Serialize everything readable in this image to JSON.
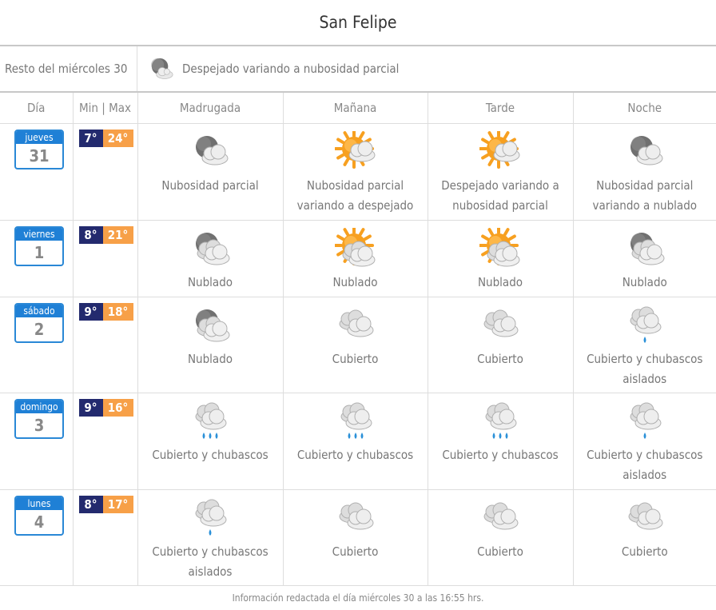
{
  "location": "San Felipe",
  "rest_of_day": {
    "label": "Resto del miércoles 30",
    "icon": "moon-cloud-icon",
    "condition": "Despejado variando a nubosidad parcial"
  },
  "headers": [
    "Día",
    "Min | Max",
    "Madrugada",
    "Mañana",
    "Tarde",
    "Noche"
  ],
  "days": [
    {
      "weekday": "jueves",
      "day": "31",
      "min": "7°",
      "max": "24°",
      "periods": [
        {
          "icon": "moon-cloud-icon",
          "text": "Nubosidad parcial"
        },
        {
          "icon": "sun-cloud-icon",
          "text": "Nubosidad parcial variando a despejado"
        },
        {
          "icon": "sun-cloud-icon",
          "text": "Despejado variando a nubosidad parcial"
        },
        {
          "icon": "moon-cloud-icon",
          "text": "Nubosidad parcial variando a nublado"
        }
      ]
    },
    {
      "weekday": "viernes",
      "day": "1",
      "min": "8°",
      "max": "21°",
      "periods": [
        {
          "icon": "moon-clouds-icon",
          "text": "Nublado"
        },
        {
          "icon": "sun-clouds-icon",
          "text": "Nublado"
        },
        {
          "icon": "sun-clouds-icon",
          "text": "Nublado"
        },
        {
          "icon": "moon-clouds-icon",
          "text": "Nublado"
        }
      ]
    },
    {
      "weekday": "sábado",
      "day": "2",
      "min": "9°",
      "max": "18°",
      "periods": [
        {
          "icon": "moon-clouds-icon",
          "text": "Nublado"
        },
        {
          "icon": "clouds-icon",
          "text": "Cubierto"
        },
        {
          "icon": "clouds-icon",
          "text": "Cubierto"
        },
        {
          "icon": "light-rain-icon",
          "text": "Cubierto y chubascos aislados"
        }
      ]
    },
    {
      "weekday": "domingo",
      "day": "3",
      "min": "9°",
      "max": "16°",
      "periods": [
        {
          "icon": "rain-icon",
          "text": "Cubierto y chubascos"
        },
        {
          "icon": "rain-icon",
          "text": "Cubierto y chubascos"
        },
        {
          "icon": "rain-icon",
          "text": "Cubierto y chubascos"
        },
        {
          "icon": "light-rain-icon",
          "text": "Cubierto y chubascos aislados"
        }
      ]
    },
    {
      "weekday": "lunes",
      "day": "4",
      "min": "8°",
      "max": "17°",
      "periods": [
        {
          "icon": "light-rain-icon",
          "text": "Cubierto y chubascos aislados"
        },
        {
          "icon": "clouds-icon",
          "text": "Cubierto"
        },
        {
          "icon": "clouds-icon",
          "text": "Cubierto"
        },
        {
          "icon": "clouds-icon",
          "text": "Cubierto"
        }
      ]
    }
  ],
  "footer": "Información redactada el día miércoles 30 a las 16:55 hrs.",
  "colors": {
    "calendar": "#1f80d6",
    "min": "#232a6e",
    "max": "#f7a048",
    "sun": "#f7a020"
  }
}
